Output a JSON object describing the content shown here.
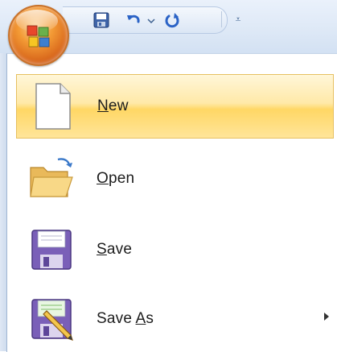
{
  "quick_access": {
    "save_icon": "floppy-save-icon",
    "undo_icon": "undo-arrow-icon",
    "undo_dropdown_icon": "small-chevron-down-icon",
    "redo_icon": "redo-circular-arrow-icon",
    "customize_glyph": "⩡",
    "customize_icon": "customize-dropdown-icon"
  },
  "office_button": {
    "icon": "office-orb-logo-icon",
    "accent": "#e57a26"
  },
  "menu": {
    "items": [
      {
        "label_pre": "",
        "label_key": "N",
        "label_post": "ew",
        "icon": "new-document-icon",
        "highlighted": true
      },
      {
        "label_pre": "",
        "label_key": "O",
        "label_post": "pen",
        "icon": "open-folder-icon",
        "highlighted": false
      },
      {
        "label_pre": "",
        "label_key": "S",
        "label_post": "ave",
        "icon": "save-floppy-icon",
        "highlighted": false
      },
      {
        "label_pre": "Save ",
        "label_key": "A",
        "label_post": "s",
        "icon": "save-as-floppy-pencil-icon",
        "highlighted": false,
        "has_submenu": true
      }
    ],
    "highlight_color": "#ffd765"
  }
}
